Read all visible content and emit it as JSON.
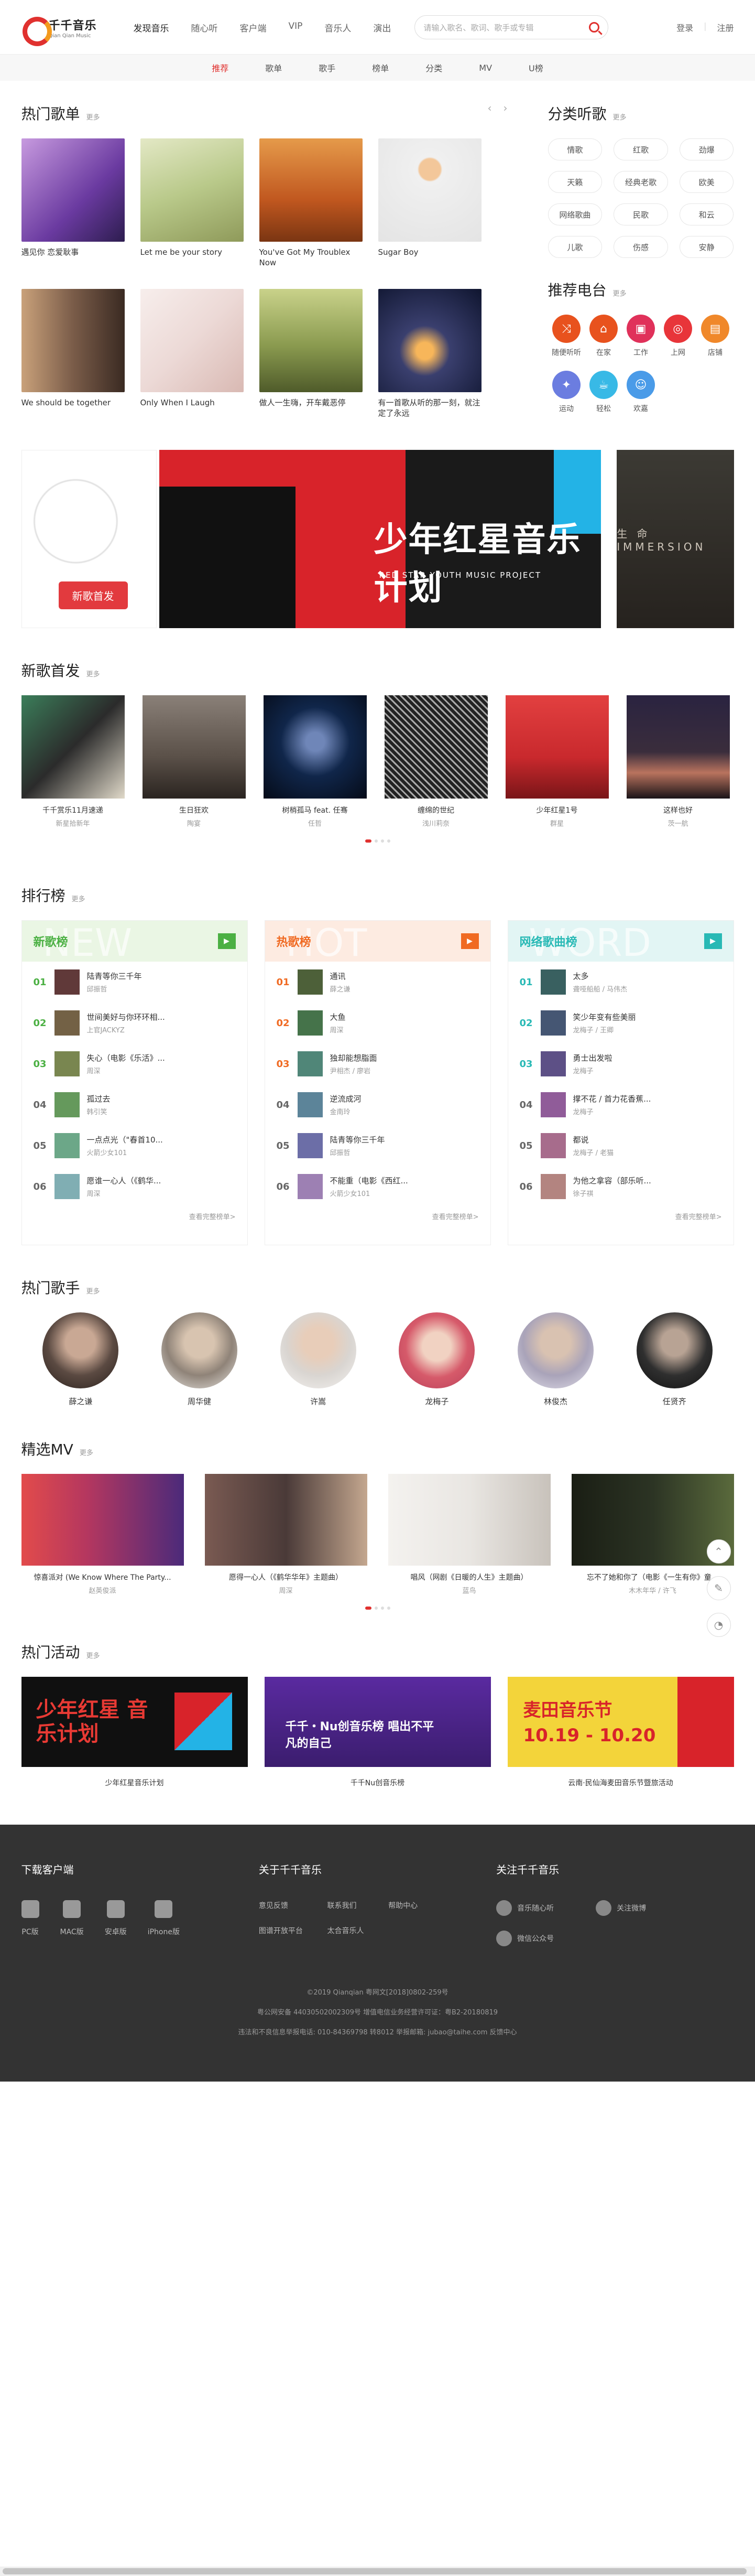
{
  "header": {
    "logo_cn": "千千音乐",
    "logo_en": "Qian Qian Music",
    "nav": [
      "发现音乐",
      "随心听",
      "客户端",
      "VIP",
      "音乐人",
      "演出"
    ],
    "search_placeholder": "请输入歌名、歌词、歌手或专辑",
    "login": "登录",
    "register": "注册"
  },
  "subnav": [
    "推荐",
    "歌单",
    "歌手",
    "榜单",
    "分类",
    "MV",
    "U榜"
  ],
  "hot_playlists": {
    "title": "热门歌单",
    "more": "更多",
    "items": [
      {
        "name": "遇见你 恋爱耿事",
        "color": "#7a4fb0"
      },
      {
        "name": "Let me be your story",
        "color": "#b9c98a"
      },
      {
        "name": "You've Got My Troublex Now",
        "color": "#c0571f"
      },
      {
        "name": "Sugar Boy",
        "color": "#e8e8e8"
      },
      {
        "name": "We should be together",
        "color": "#7a5c49"
      },
      {
        "name": "Only When I Laugh",
        "color": "#ecd9d6"
      },
      {
        "name": "做人一生嗨，开车戴恶停",
        "color": "#8a9a4f"
      },
      {
        "name": "有一首歌从听的那一刻，就注定了永远",
        "color": "#1f2a52"
      }
    ]
  },
  "categories": {
    "title": "分类听歌",
    "more": "更多",
    "tags": [
      "情歌",
      "红歌",
      "劲爆",
      "天籁",
      "经典老歌",
      "欧美",
      "网络歌曲",
      "民歌",
      "和云",
      "儿歌",
      "伤感",
      "安静"
    ]
  },
  "radio": {
    "title": "推荐电台",
    "more": "更多",
    "items": [
      {
        "name": "随便听听",
        "color": "#e8521e",
        "icon": "shuffle-icon",
        "glyph": "⤨"
      },
      {
        "name": "在家",
        "color": "#e8521e",
        "icon": "home-icon",
        "glyph": "⌂"
      },
      {
        "name": "工作",
        "color": "#e0315a",
        "icon": "briefcase-icon",
        "glyph": "▣"
      },
      {
        "name": "上网",
        "color": "#e8353a",
        "icon": "globe-icon",
        "glyph": "◎"
      },
      {
        "name": "店铺",
        "color": "#f0882a",
        "icon": "shop-icon",
        "glyph": "▤"
      },
      {
        "name": "运动",
        "color": "#6b7de0",
        "icon": "run-icon",
        "glyph": "✦"
      },
      {
        "name": "轻松",
        "color": "#38b9e6",
        "icon": "coffee-icon",
        "glyph": "☕"
      },
      {
        "name": "欢嘉",
        "color": "#4a9be8",
        "icon": "smile-icon",
        "glyph": "☺"
      }
    ]
  },
  "banner": {
    "left_tag": "新歌首发",
    "main_title": "少年红星音乐计划",
    "main_sub": "RED STAR YOUTH MUSIC PROJECT",
    "right_text": "生 命 IMMERSION"
  },
  "new_songs": {
    "title": "新歌首发",
    "more": "更多",
    "items": [
      {
        "title": "千千赏乐11月速递",
        "artist": "新星拾新年",
        "color": "#2b2b2b"
      },
      {
        "title": "生日狂欢",
        "artist": "陶宴",
        "color": "#5a5048"
      },
      {
        "title": "树梢孤马 feat. 任骞",
        "artist": "任哲",
        "color": "#10264a"
      },
      {
        "title": "缠绵的世纪",
        "artist": "浅川莉奈",
        "color": "#777777"
      },
      {
        "title": "少年红星1号",
        "artist": "群星",
        "color": "#c9292d"
      },
      {
        "title": "这样也好",
        "artist": "茨一航",
        "color": "#3a2d3c"
      }
    ]
  },
  "rankings": {
    "title": "排行榜",
    "more": "更多",
    "lists": [
      {
        "name": "新歌榜",
        "bg_word": "NEW",
        "accent": "#4bb043",
        "head_bg": "#eaf6e4",
        "rows": [
          {
            "no": "01",
            "title": "陆青等你三千年",
            "artist": "邱振哲"
          },
          {
            "no": "02",
            "title": "世间美好与你环环相...",
            "artist": "上官JACKYZ"
          },
          {
            "no": "03",
            "title": "失心（电影《乐活》...",
            "artist": "周深"
          },
          {
            "no": "04",
            "title": "孤过去",
            "artist": "韩引笑"
          },
          {
            "no": "05",
            "title": "一点点光（\"春首10...",
            "artist": "火箭少女101"
          },
          {
            "no": "06",
            "title": "愿谁一心人（《鹤华...",
            "artist": "周深"
          }
        ],
        "more": "查看完整榜单>"
      },
      {
        "name": "热歌榜",
        "bg_word": "HOT",
        "accent": "#f06a22",
        "head_bg": "#fdebe1",
        "rows": [
          {
            "no": "01",
            "title": "通讯",
            "artist": "薛之谦"
          },
          {
            "no": "02",
            "title": "大鱼",
            "artist": "周深"
          },
          {
            "no": "03",
            "title": "独却能想脂面",
            "artist": "尹相杰 / 廖岩"
          },
          {
            "no": "04",
            "title": "逆流成河",
            "artist": "金南玲"
          },
          {
            "no": "05",
            "title": "陆青等你三千年",
            "artist": "邱振哲"
          },
          {
            "no": "06",
            "title": "不能重（电影《西红...",
            "artist": "火箭少女101"
          }
        ],
        "more": "查看完整榜单>"
      },
      {
        "name": "网络歌曲榜",
        "bg_word": "WORD",
        "accent": "#28b9b5",
        "head_bg": "#e2f5f4",
        "rows": [
          {
            "no": "01",
            "title": "太多",
            "artist": "聋哑船船 / 马伟杰"
          },
          {
            "no": "02",
            "title": "笑少年变有些美丽",
            "artist": "龙梅子 / 王卿"
          },
          {
            "no": "03",
            "title": "勇士出发啦",
            "artist": "龙梅子"
          },
          {
            "no": "04",
            "title": "撑不花 / 首力花香蕉...",
            "artist": "龙梅子"
          },
          {
            "no": "05",
            "title": "都说",
            "artist": "龙梅子 / 老猫"
          },
          {
            "no": "06",
            "title": "为他之拿容（部乐听...",
            "artist": "徐子祺"
          }
        ],
        "more": "查看完整榜单>"
      }
    ]
  },
  "singers": {
    "title": "热门歌手",
    "more": "更多",
    "items": [
      {
        "name": "薛之谦",
        "color": "#5b4a42"
      },
      {
        "name": "周华健",
        "color": "#8f8378"
      },
      {
        "name": "许嵩",
        "color": "#d9d5d1"
      },
      {
        "name": "龙梅子",
        "color": "#d65a6a"
      },
      {
        "name": "林俊杰",
        "color": "#a9a3b9"
      },
      {
        "name": "任贤齐",
        "color": "#2f2f2f"
      }
    ]
  },
  "mv": {
    "title": "精选MV",
    "more": "更多",
    "items": [
      {
        "title": "惊喜派对 (We Know Where The Party...",
        "artist": "赵英俊派",
        "color": "#b5375f"
      },
      {
        "title": "愿得一心人（《鹤华华年》主题曲）",
        "artist": "周深",
        "color": "#4a3a38"
      },
      {
        "title": "唱风（网剧《日暖的人生》主题曲）",
        "artist": "蓝鸟",
        "color": "#e9e6e2"
      },
      {
        "title": "忘不了她和你了（电影《一生有你》童...",
        "artist": "木木年华 / 许飞",
        "color": "#2c3424"
      }
    ]
  },
  "events": {
    "title": "热门活动",
    "more": "更多",
    "items": [
      {
        "title": "少年红星音乐计划",
        "banner_text": "少年红星 音乐计划",
        "color": "#101010",
        "text_color": "#e83a34"
      },
      {
        "title": "千千Nu创音乐榜",
        "banner_text": "千千・Nu创音乐榜 唱出不平凡的自己",
        "color": "#3b1d6e",
        "text_color": "#ffffff"
      },
      {
        "title": "云南·民仙海麦田音乐节暨旅活动",
        "banner_text": "麦田音乐节 10.19 - 10.20",
        "color": "#f3d43a",
        "text_color": "#d8232a"
      }
    ]
  },
  "footer": {
    "download_title": "下载客户端",
    "downloads": [
      "PC版",
      "MAC版",
      "安卓版",
      "iPhone版"
    ],
    "about_title": "关于千千音乐",
    "links": [
      "意见反馈",
      "联系我们",
      "帮助中心",
      "图谱开放平台",
      "太合音乐人"
    ],
    "follow_title": "关注千千音乐",
    "follow": [
      "音乐随心听",
      "关注微博",
      "微信公众号"
    ],
    "copyright": [
      "©2019 Qianqian 粤网文[2018]0802-259号",
      "粤公网安备 44030502002309号 增值电信业务经营许可证：粤B2-20180819",
      "违法和不良信息举报电话: 010-84369798 转8012  举报邮箱: jubao@taihe.com  反馈中心"
    ]
  }
}
